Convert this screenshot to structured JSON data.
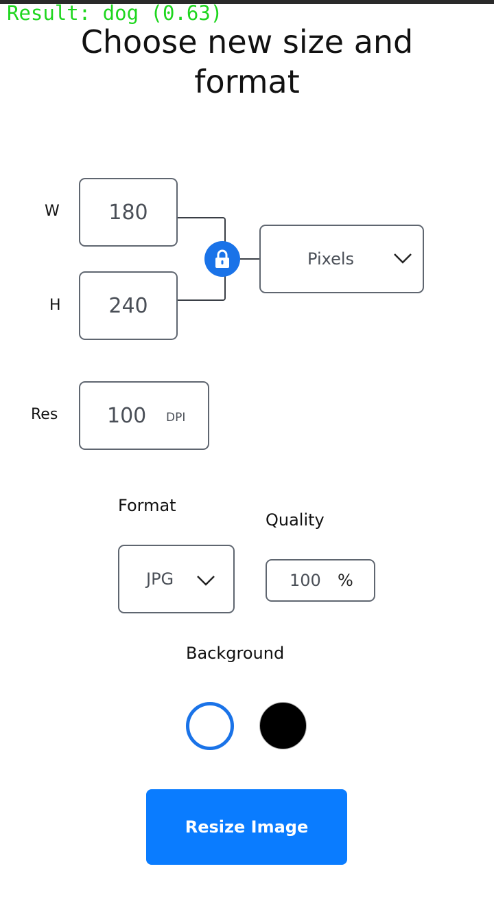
{
  "overlay": {
    "result_text": "Result: dog (0.63)"
  },
  "header": {
    "title": "Choose new size and format"
  },
  "dimensions": {
    "width_label": "W",
    "width_value": "180",
    "height_label": "H",
    "height_value": "240",
    "unit_selected": "Pixels",
    "aspect_lock": "lock-icon"
  },
  "resolution": {
    "label": "Res",
    "value": "100",
    "unit": "DPI"
  },
  "format": {
    "label": "Format",
    "selected": "JPG"
  },
  "quality": {
    "label": "Quality",
    "value": "100",
    "unit": "%"
  },
  "background": {
    "label": "Background",
    "options": [
      {
        "name": "white",
        "color": "#ffffff",
        "selected": true
      },
      {
        "name": "black",
        "color": "#000000",
        "selected": false
      }
    ]
  },
  "actions": {
    "resize_label": "Resize Image"
  },
  "colors": {
    "accent": "#0a7cff",
    "overlay": "#1ed61e"
  }
}
